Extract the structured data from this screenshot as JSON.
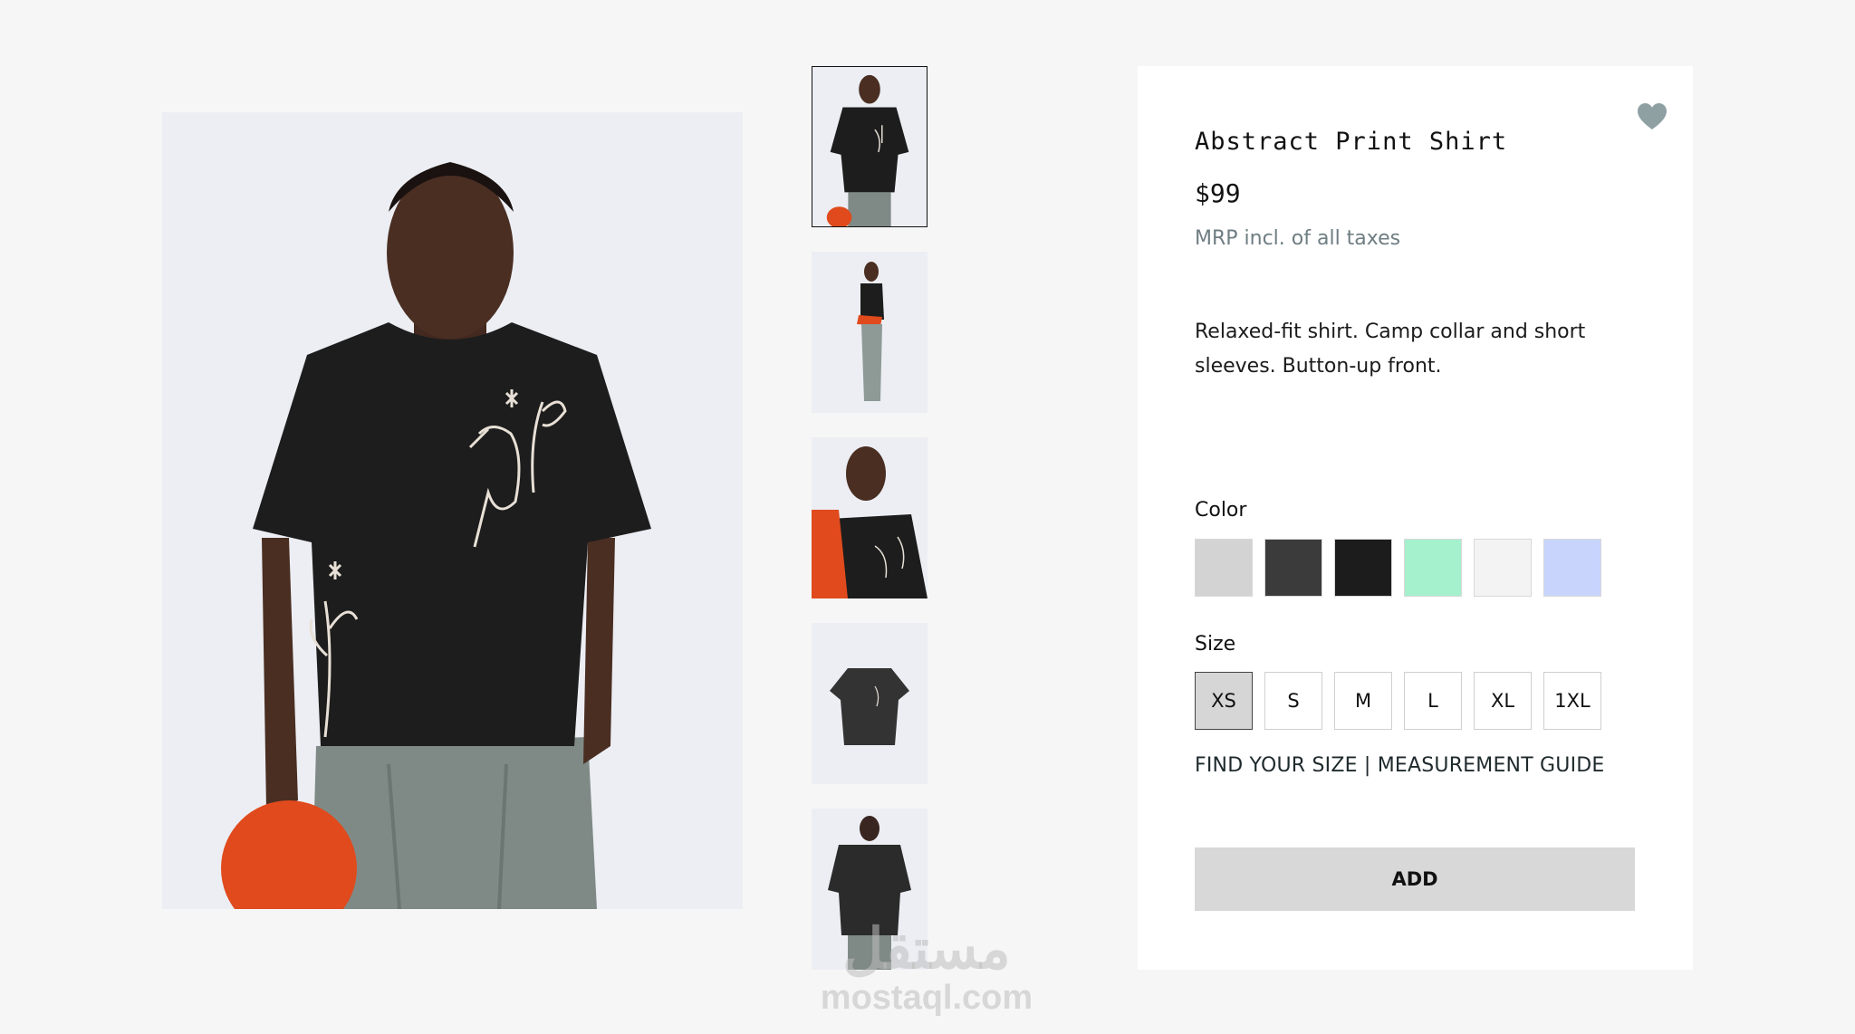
{
  "product": {
    "title": "Abstract Print Shirt",
    "price": "$99",
    "tax_note": "MRP incl. of all taxes",
    "description": "Relaxed-fit shirt. Camp collar and short sleeves. Button-up front."
  },
  "colors": {
    "label": "Color",
    "options": [
      "#d3d3d3",
      "#3b3b3b",
      "#1c1c1c",
      "#a5f0cd",
      "#f3f3f3",
      "#c8d4fc"
    ]
  },
  "sizes": {
    "label": "Size",
    "options": [
      "XS",
      "S",
      "M",
      "L",
      "XL",
      "1XL"
    ],
    "selected": "XS"
  },
  "size_guide_label": "FIND YOUR SIZE | MEASUREMENT GUIDE",
  "add_button_label": "ADD",
  "wishlist_color": "#8fa0a3",
  "thumbnails": [
    {
      "view": "front",
      "selected": true
    },
    {
      "view": "side",
      "selected": false
    },
    {
      "view": "close-up",
      "selected": false
    },
    {
      "view": "flat-lay",
      "selected": false
    },
    {
      "view": "back",
      "selected": false
    }
  ],
  "watermark": {
    "arabic": "مستقل",
    "latin": "mostaql.com"
  }
}
